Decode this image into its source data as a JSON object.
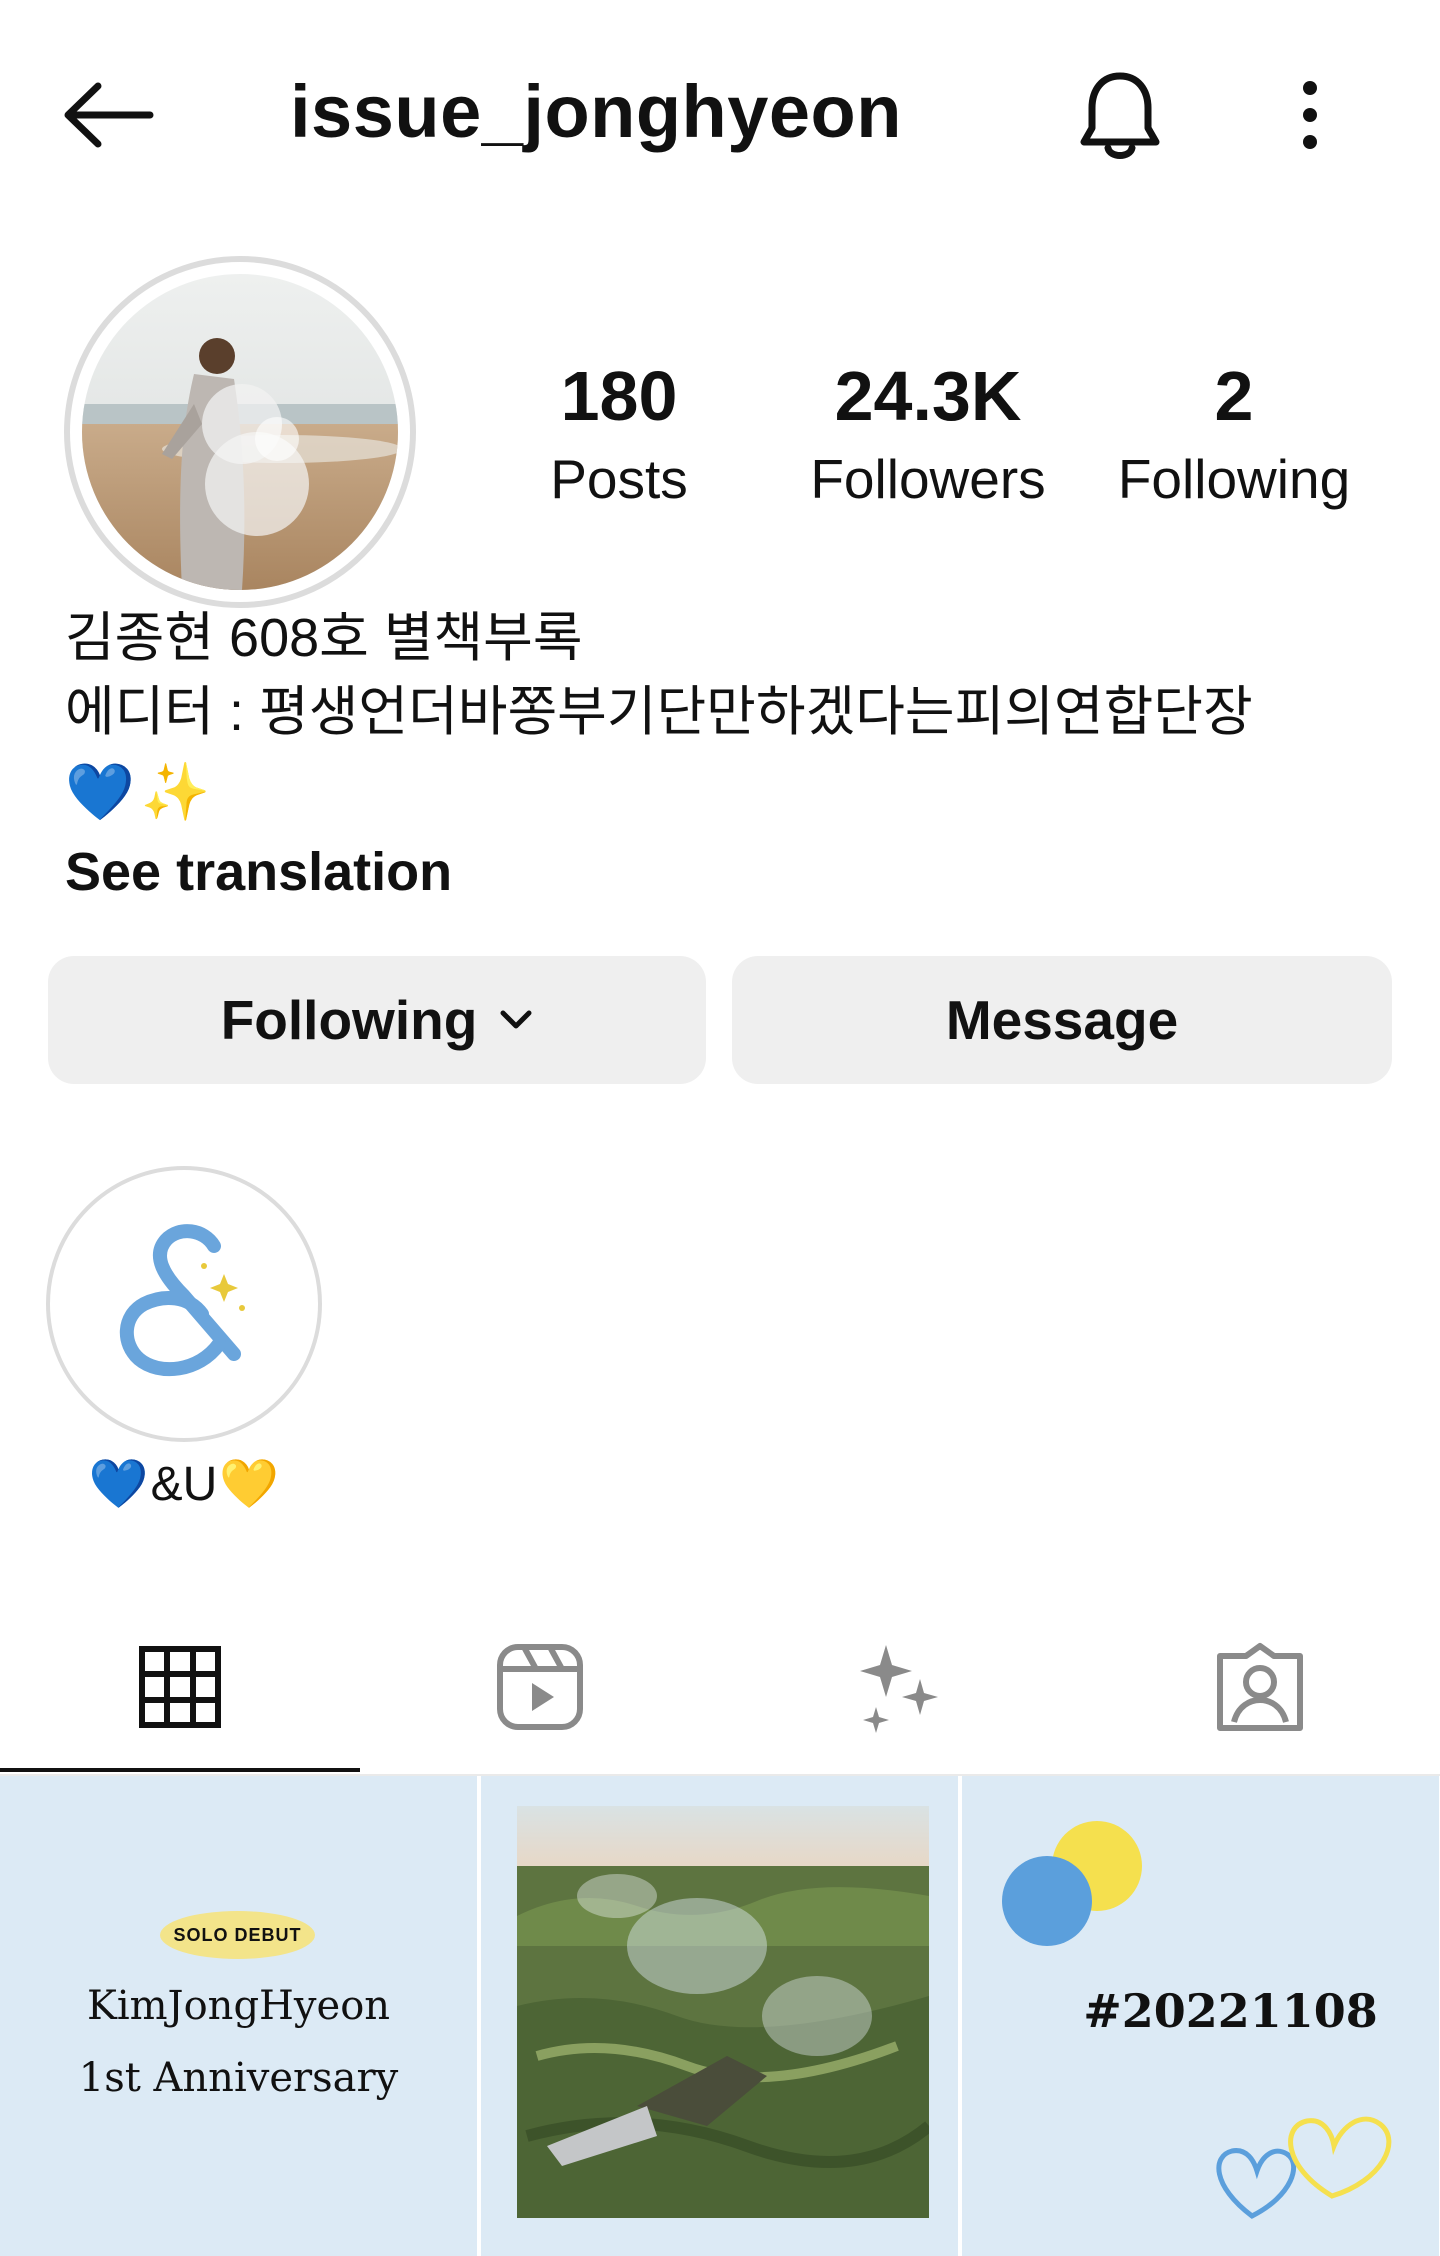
{
  "header": {
    "username": "issue_jonghyeon",
    "icons": [
      "back-arrow-icon",
      "bell-icon",
      "more-vertical-icon"
    ]
  },
  "profile": {
    "stats": [
      {
        "value": "180",
        "label": "Posts"
      },
      {
        "value": "24.3K",
        "label": "Followers"
      },
      {
        "value": "2",
        "label": "Following"
      }
    ],
    "bio_name": "김종현 608호 별책부록",
    "bio_line2": "에디터 : 평생언더바쫑부기단만하겠다는피의연합단장",
    "bio_emoji": [
      "💙",
      "✨"
    ],
    "see_translation": "See translation"
  },
  "actions": {
    "following_label": "Following",
    "message_label": "Message"
  },
  "highlights": [
    {
      "label_parts": [
        "💙",
        "&U",
        "💛"
      ],
      "icon": "ampersand-icon"
    }
  ],
  "tabs": [
    {
      "name": "grid",
      "icon": "grid-icon",
      "active": true
    },
    {
      "name": "reels",
      "icon": "reels-icon",
      "active": false
    },
    {
      "name": "effects",
      "icon": "sparkles-icon",
      "active": false
    },
    {
      "name": "tagged",
      "icon": "tagged-person-icon",
      "active": false
    }
  ],
  "posts": [
    {
      "badge": "SOLO DEBUT",
      "line1": "KimJongHyeon",
      "line2": "1st Anniversary"
    },
    {
      "type": "photo"
    },
    {
      "hashtag": "#20221108"
    }
  ],
  "colors": {
    "button_bg": "#efefef",
    "post_bg": "#dceaf5",
    "accent_blue": "#5b9fdc",
    "accent_yellow": "#f5e04e"
  }
}
